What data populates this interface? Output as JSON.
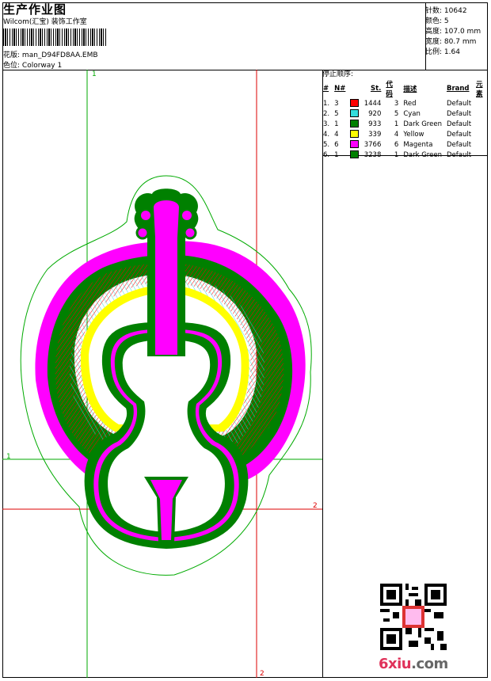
{
  "header": {
    "title": "生产作业图",
    "company": "Wilcom(汇宝) 装饰工作室",
    "design_label": "花版:",
    "design_file": "man_D94FD8AA.EMB",
    "color_label": "色位:",
    "colorway": "Colorway 1"
  },
  "stats": [
    {
      "label": "针数:",
      "value": "10642"
    },
    {
      "label": "颜色:",
      "value": "5"
    },
    {
      "label": "高度:",
      "value": "107.0 mm"
    },
    {
      "label": "宽度:",
      "value": "80.7 mm"
    },
    {
      "label": "比例:",
      "value": "1.64"
    }
  ],
  "stop_sequence": {
    "heading": "停止顺序:",
    "columns": [
      "#",
      "N#",
      "St.",
      "代码",
      "描述",
      "Brand",
      "元素"
    ],
    "rows": [
      {
        "idx": "1.",
        "n": "3",
        "color": "#ff0000",
        "st": "1444",
        "code": "3",
        "desc": "Red",
        "brand": "Default"
      },
      {
        "idx": "2.",
        "n": "5",
        "color": "#33dddd",
        "st": "920",
        "code": "5",
        "desc": "Cyan",
        "brand": "Default"
      },
      {
        "idx": "3.",
        "n": "1",
        "color": "#008000",
        "st": "933",
        "code": "1",
        "desc": "Dark Green",
        "brand": "Default"
      },
      {
        "idx": "4.",
        "n": "4",
        "color": "#ffff00",
        "st": "339",
        "code": "4",
        "desc": "Yellow",
        "brand": "Default"
      },
      {
        "idx": "5.",
        "n": "6",
        "color": "#ff00ff",
        "st": "3766",
        "code": "6",
        "desc": "Magenta",
        "brand": "Default"
      },
      {
        "idx": "6.",
        "n": "1",
        "color": "#008000",
        "st": "3238",
        "code": "1",
        "desc": "Dark Green",
        "brand": "Default"
      }
    ]
  },
  "markers": {
    "green_1": "1",
    "red_2": "2"
  },
  "watermark": {
    "brand": "6xiu",
    "brand_tld": ".com"
  },
  "colors": {
    "green": "#00aa00",
    "red": "#dd0000",
    "magenta": "#ff00ff",
    "cyan": "#33dddd",
    "yellow": "#ffff00",
    "dark_green": "#008000"
  }
}
